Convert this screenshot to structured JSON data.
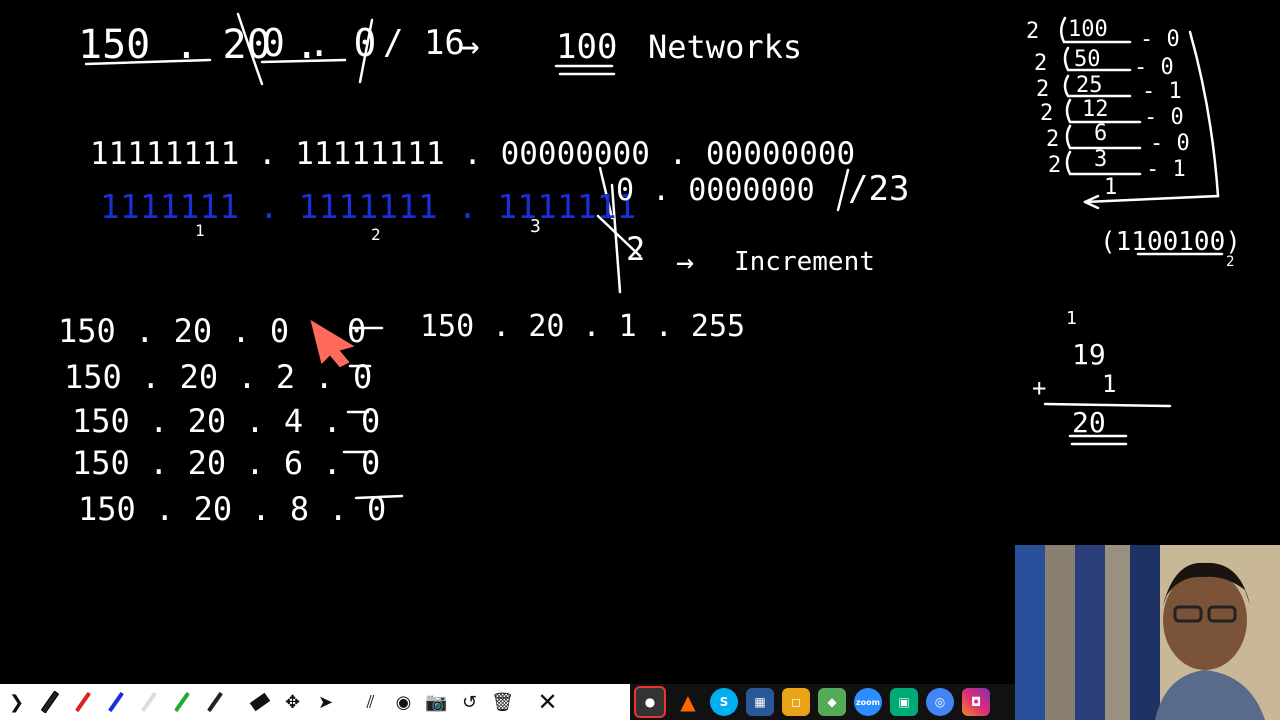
{
  "board": {
    "title": {
      "ip_part1": "150 . 20 .",
      "ip_part2": "0 . 0",
      "prefix": "/ 16",
      "arrow": "→",
      "count": "100",
      "label": "Networks"
    },
    "mask_row": "11111111 . 11111111 . 00000000 . 00000000",
    "borrow_row": {
      "ones": "1111111 . 1111111 . 1111111",
      "rest": "0 . 0000000",
      "prefix": "/23",
      "group_numbers": [
        "1",
        "2",
        "3"
      ]
    },
    "increment_note": {
      "value": "2",
      "arrow": "→",
      "label": "Increment"
    },
    "subnets": [
      {
        "ip": "150 . 20 . 0 . 0",
        "range_end": "150 . 20 . 1 . 255"
      },
      {
        "ip": "150 . 20 . 2 . 0",
        "range_end": ""
      },
      {
        "ip": "150 . 20 . 4 . 0",
        "range_end": ""
      },
      {
        "ip": "150 . 20 . 6 . 0",
        "range_end": ""
      },
      {
        "ip": "150 . 20 . 8 . 0",
        "range_end": ""
      }
    ],
    "division": {
      "rows": [
        {
          "divisor": "2",
          "value": "100",
          "remainder": "- 0"
        },
        {
          "divisor": "2",
          "value": "50",
          "remainder": "- 0"
        },
        {
          "divisor": "2",
          "value": "25",
          "remainder": "- 1"
        },
        {
          "divisor": "2",
          "value": "12",
          "remainder": "- 0"
        },
        {
          "divisor": "2",
          "value": "6",
          "remainder": "- 0"
        },
        {
          "divisor": "2",
          "value": "3",
          "remainder": "- 1"
        }
      ],
      "last": "1",
      "result": "(1100100)",
      "base": "2"
    },
    "addition": {
      "carry": "1",
      "top": "19",
      "plus": "+",
      "bottom": "1",
      "sum": "20"
    }
  },
  "toolbar": {
    "items": [
      "pen-white",
      "pen-red",
      "pen-blue",
      "pen-white-2",
      "pen-green",
      "pen-white-3",
      "eraser",
      "move",
      "pointer",
      "lines",
      "eye",
      "camera",
      "undo",
      "trash",
      "close"
    ],
    "colors": {
      "white": "#ffffff",
      "red": "#e02020",
      "blue": "#1a2fd6",
      "green": "#22aa33",
      "pointer": "#ff6b5b"
    }
  },
  "taskbar": {
    "apps": [
      "obs-icon",
      "vlc-icon",
      "skype-icon",
      "app-icon",
      "app-icon-2",
      "app-icon-3",
      "zoom-icon",
      "app-icon-4",
      "chrome-icon",
      "instagram-icon"
    ],
    "zoom_label": "zoom"
  }
}
